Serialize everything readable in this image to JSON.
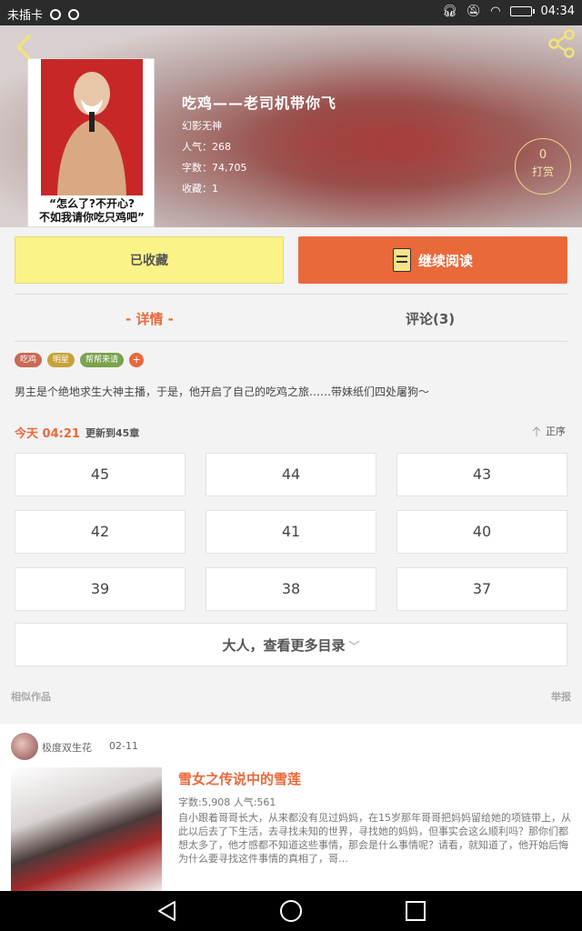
{
  "status_bar": {
    "carrier": "未插卡",
    "time": "04:34"
  },
  "book": {
    "title": "吃鸡——老司机带你飞",
    "author": "幻影无神",
    "popularity": "人气：268",
    "word_count": "字数：74,705",
    "favorites": "收藏：1",
    "cover_text_line1": "“怎么了?不开心?",
    "cover_text_line2": "不如我请你吃只鸡吧”",
    "tip_count": "0",
    "tip_label": "打赏"
  },
  "actions": {
    "collected_label": "已收藏",
    "continue_label": "继续阅读"
  },
  "tabs": {
    "detail": "- 详情 -",
    "comments": "评论(3)"
  },
  "tags": [
    {
      "label": "吃鸡",
      "color": "#c96a55"
    },
    {
      "label": "明星",
      "color": "#c9a13a"
    },
    {
      "label": "帮帮来请",
      "color": "#7ba24d"
    }
  ],
  "intro": "男主是个绝地求生大神主播，于是，他开启了自己的吃鸡之旅……带妹纸们四处屠狗～",
  "update": {
    "time": "今天 04:21",
    "text": "更新到45章",
    "order_label": "正序"
  },
  "chapters": [
    "45",
    "44",
    "43",
    "42",
    "41",
    "40",
    "39",
    "38",
    "37"
  ],
  "more_chapters": "大人，查看更多目录",
  "similar_label": "相似作品",
  "report_label": "举报",
  "recommend": {
    "author": "极度双生花",
    "date": "02-11",
    "title": "雪女之传说中的雪莲",
    "stats": "字数:5,908   人气:561",
    "description": "自小跟着哥哥长大，从来都没有见过妈妈，在15岁那年哥哥把妈妈留给她的项链带上，从此以后去了下生活，去寻找未知的世界，寻找她的妈妈，但事实会这么顺利吗？那你们都想太多了，他才感都不知道这些事情，那会是什么事情呢？请看，就知道了，他开始后悔为什么要寻找这件事情的真相了，哥…"
  },
  "colors": {
    "accent": "#e9693b",
    "collected_bg": "#fbf387"
  }
}
